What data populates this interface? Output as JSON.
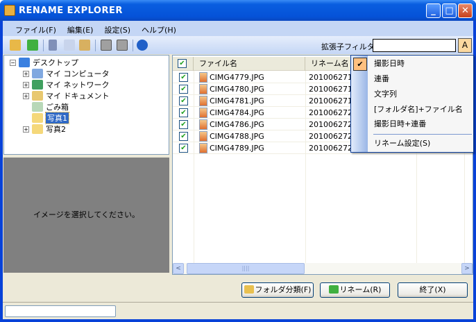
{
  "window": {
    "title": "RENAME EXPLORER",
    "minimize": "_",
    "maximize": "□",
    "close": "✕"
  },
  "menu": [
    "ファイル(F)",
    "編集(E)",
    "設定(S)",
    "ヘルプ(H)"
  ],
  "toolbar": {
    "icons": [
      "open-folder-icon",
      "rename-icon",
      "cut-icon",
      "copy-icon",
      "paste-icon",
      "move-up-icon",
      "move-down-icon",
      "help-icon"
    ],
    "filter_label": "拡張子フィルタ",
    "filter_value": "",
    "filter_button": "A"
  },
  "tree": [
    {
      "label": "デスクトップ",
      "expander": "−",
      "level": 0
    },
    {
      "label": "マイ コンピュータ",
      "expander": "+",
      "level": 1
    },
    {
      "label": "マイ ネットワーク",
      "expander": "+",
      "level": 1
    },
    {
      "label": "マイ ドキュメント",
      "expander": "+",
      "level": 1
    },
    {
      "label": "ごみ箱",
      "expander": "",
      "level": 1
    },
    {
      "label": "写真1",
      "expander": "",
      "level": 1,
      "selected": true
    },
    {
      "label": "写真2",
      "expander": "+",
      "level": 1
    }
  ],
  "preview": {
    "message": "イメージを選択してください。"
  },
  "list": {
    "headers": {
      "check": "✔",
      "filename": "ファイル名",
      "rename": "リネーム名"
    },
    "rows": [
      {
        "checked": "✔",
        "filename": "CIMG4779.JPG",
        "rename": "2010062716"
      },
      {
        "checked": "✔",
        "filename": "CIMG4780.JPG",
        "rename": "2010062716"
      },
      {
        "checked": "✔",
        "filename": "CIMG4781.JPG",
        "rename": "2010062716"
      },
      {
        "checked": "✔",
        "filename": "CIMG4784.JPG",
        "rename": "2010062721"
      },
      {
        "checked": "✔",
        "filename": "CIMG4786.JPG",
        "rename": "2010062721"
      },
      {
        "checked": "✔",
        "filename": "CIMG4788.JPG",
        "rename": "2010062721"
      },
      {
        "checked": "✔",
        "filename": "CIMG4789.JPG",
        "rename": "2010062721"
      }
    ],
    "scroll_left": "<",
    "scroll_right": ">",
    "thumb_grip": "||||"
  },
  "popup_menu": {
    "check": "✔",
    "items": [
      "撮影日時",
      "連番",
      "文字列",
      "[フォルダ名]+ファイル名",
      "撮影日時+連番"
    ],
    "settings": "リネーム設定(S)",
    "checked_index": 0
  },
  "buttons": {
    "folder": "フォルダ分類(F)",
    "rename": "リネーム(R)",
    "exit": "終了(X)"
  }
}
